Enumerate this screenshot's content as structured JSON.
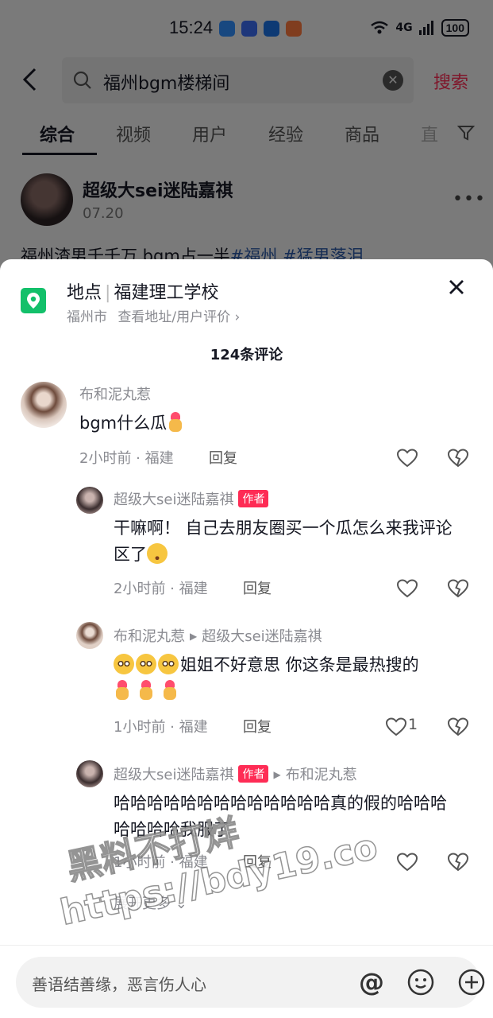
{
  "status_bar": {
    "time": "15:24",
    "network": "4G",
    "battery": "100"
  },
  "search": {
    "query": "福州bgm楼梯间",
    "search_label": "搜索"
  },
  "tabs": [
    {
      "label": "综合",
      "active": true
    },
    {
      "label": "视频"
    },
    {
      "label": "用户"
    },
    {
      "label": "经验"
    },
    {
      "label": "商品"
    },
    {
      "label": "直"
    }
  ],
  "post": {
    "author": "超级大sei迷陆嘉祺",
    "date": "07.20",
    "caption_text": "福州渣男千千万 bgm占一半",
    "caption_tags": [
      "#福州",
      "#猛男落泪"
    ]
  },
  "location": {
    "label": "地点",
    "name": "福建理工学校",
    "city": "福州市",
    "link": "查看地址/用户评价"
  },
  "comments_count": "124条评论",
  "comments": [
    {
      "user": "布和泥丸惹",
      "text": "bgm什么瓜",
      "time": "2小时前 · 福建",
      "reply_label": "回复"
    },
    {
      "user": "超级大sei迷陆嘉祺",
      "badge": "作者",
      "text": "干嘛啊！ 自己去朋友圈买一个瓜怎么来我评论区了",
      "time": "2小时前 · 福建",
      "reply_label": "回复"
    },
    {
      "user": "布和泥丸惹",
      "reply_to": "超级大sei迷陆嘉祺",
      "text": "姐姐不好意思 你这条是最热搜的",
      "time": "1小时前 · 福建",
      "reply_label": "回复",
      "likes": "1"
    },
    {
      "user": "超级大sei迷陆嘉祺",
      "badge": "作者",
      "reply_to": "布和泥丸惹",
      "text": "哈哈哈哈哈哈哈哈哈哈哈哈哈真的假的哈哈哈哈哈哈哈我服了",
      "time": "1小时前 · 福建",
      "reply_label": "回复"
    }
  ],
  "expand_label": "展开更多",
  "input": {
    "placeholder": "善语结善缘，恶言伤人心"
  },
  "watermark": {
    "line1": "黑料不打烊",
    "line2": "https://bdy19.co"
  },
  "colors": {
    "accent": "#fe2c55",
    "location_green": "#13c06a",
    "hashtag": "#2d5aa8"
  }
}
